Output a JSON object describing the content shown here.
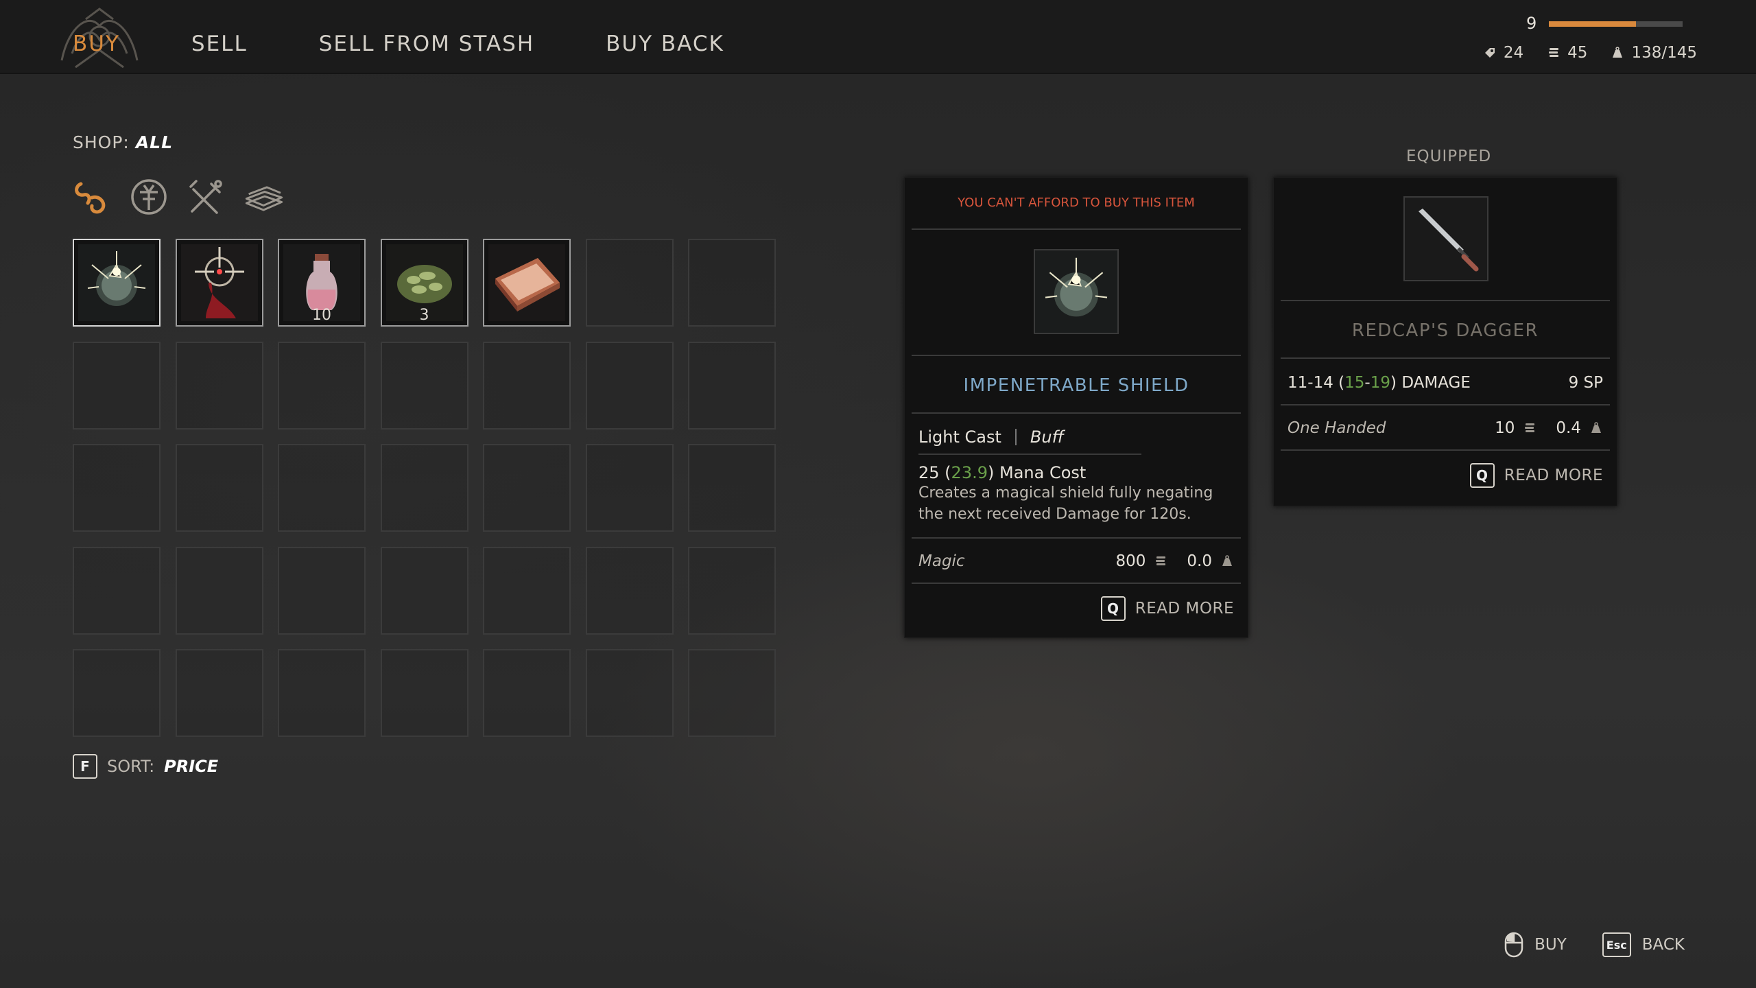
{
  "tabs": [
    {
      "label": "BUY",
      "active": true
    },
    {
      "label": "SELL"
    },
    {
      "label": "SELL FROM STASH"
    },
    {
      "label": "BUY BACK"
    }
  ],
  "player": {
    "level": "9",
    "xp_progress": 0.65,
    "skill_points": "24",
    "coins": "45",
    "weight": "138/145"
  },
  "shop": {
    "label": "SHOP:",
    "filter_value": "ALL",
    "filters": [
      "chain-link-icon",
      "magic-rune-icon",
      "crafting-tools-icon",
      "books-icon"
    ],
    "items": [
      {
        "name": "impenetrable-shield-item",
        "icon": "shield-orb-icon",
        "qty": ""
      },
      {
        "name": "blood-spell-item",
        "icon": "blood-spell-icon",
        "qty": ""
      },
      {
        "name": "potion-item",
        "icon": "potion-bottle-icon",
        "qty": "10"
      },
      {
        "name": "herb-item",
        "icon": "herb-icon",
        "qty": "3"
      },
      {
        "name": "book-item",
        "icon": "book-icon",
        "qty": ""
      }
    ],
    "total_slots": 35
  },
  "sort": {
    "key": "F",
    "label": "SORT:",
    "value": "PRICE"
  },
  "tooltip": {
    "warning": "YOU CAN'T AFFORD TO BUY THIS ITEM",
    "title": "IMPENETRABLE SHIELD",
    "type": "Light Cast",
    "subtype": "Buff",
    "mana_base": "25",
    "mana_mod": "23.9",
    "mana_label": "Mana Cost",
    "description": "Creates a magical shield fully negating the next received Damage for 120s.",
    "category": "Magic",
    "price": "800",
    "weight": "0.0",
    "read_more_key": "Q",
    "read_more": "READ MORE"
  },
  "equipped": {
    "header": "EQUIPPED",
    "name": "REDCAP'S DAGGER",
    "damage_base": "11-14",
    "damage_mod_low": "15",
    "damage_mod_high": "19",
    "damage_label": "DAMAGE",
    "sp": "9 SP",
    "handed": "One Handed",
    "price": "10",
    "weight": "0.4",
    "read_more_key": "Q",
    "read_more": "READ MORE"
  },
  "footer": {
    "buy_label": "BUY",
    "back_key": "Esc",
    "back_label": "BACK"
  },
  "colors": {
    "accent": "#d88a3c",
    "title_blue": "#7ea8c8",
    "warning": "#d8553c",
    "bonus_green": "#6aa04a"
  }
}
